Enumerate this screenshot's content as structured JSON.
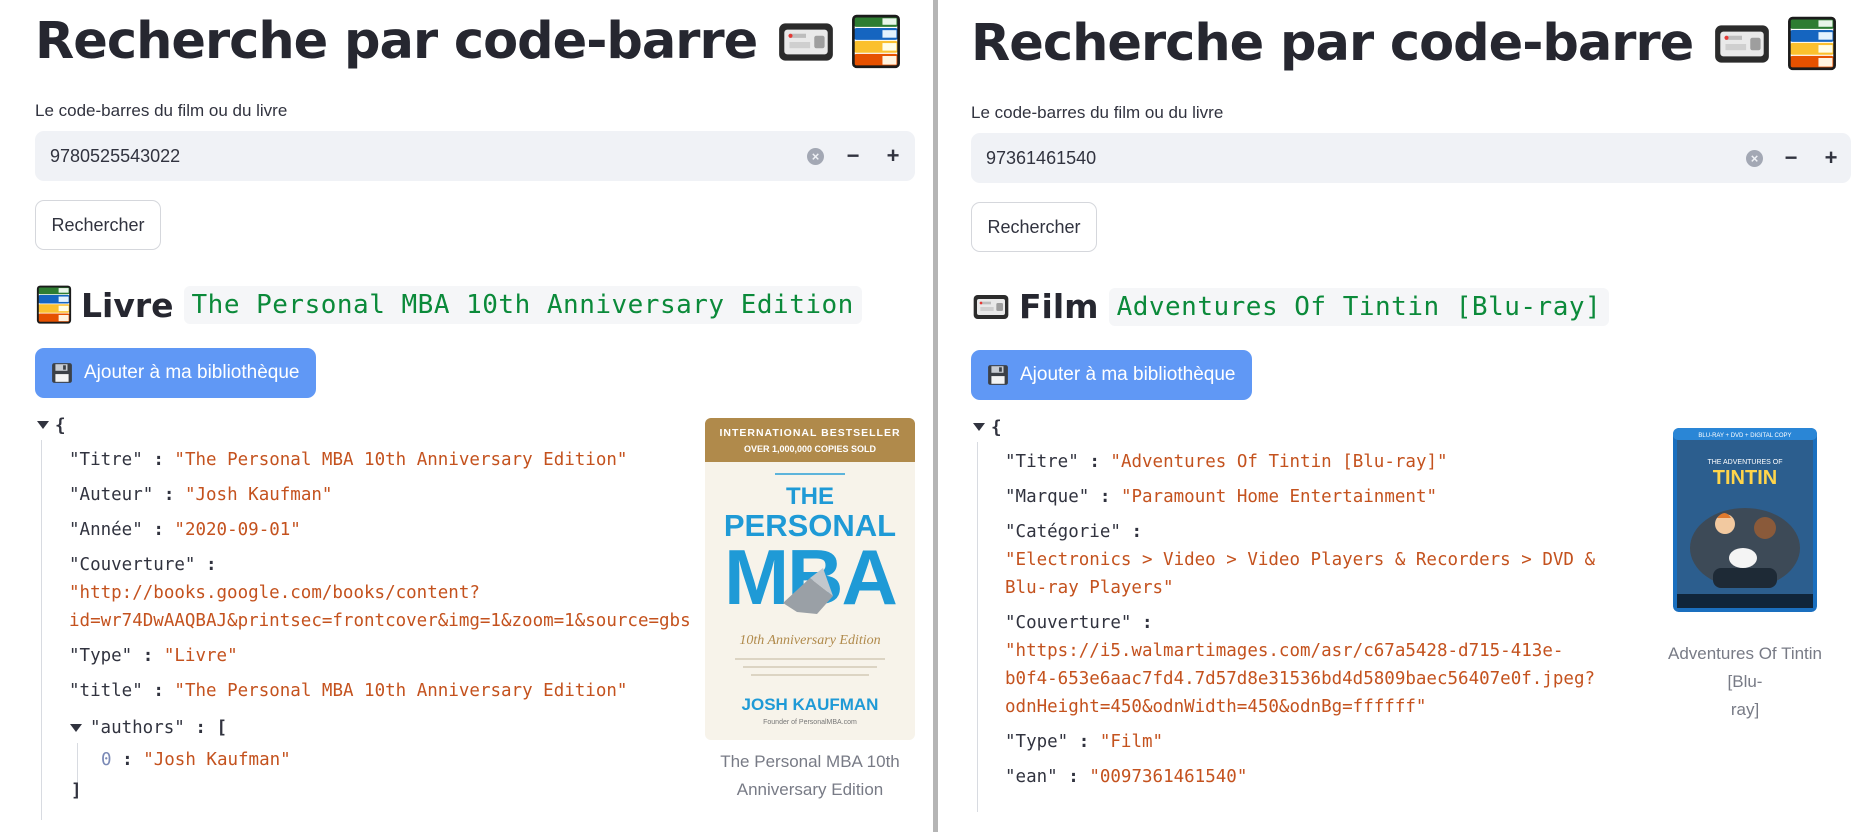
{
  "colors": {
    "primary_button": "#6098f5",
    "json_string": "#c4521e",
    "code_green": "#0b8a3a",
    "input_background": "#f0f2f6"
  },
  "left": {
    "title": "Recherche par code-barre",
    "title_icons": [
      "video-camera-icon",
      "books-icon"
    ],
    "barcode": {
      "label": "Le code-barres du film ou du livre",
      "value": "9780525543022",
      "clear_icon": "clear-icon",
      "minus": "−",
      "plus": "+"
    },
    "search_button": "Rechercher",
    "result": {
      "icon": "books-icon",
      "kind": "Livre",
      "title_code": "The Personal MBA 10th Anniversary Edition"
    },
    "add_button": "Ajouter à ma bibliothèque",
    "add_icon": "floppy-disk-icon",
    "json": {
      "open_brace": "{",
      "entries": [
        {
          "key": "\"Titre\"",
          "value": "\"The Personal MBA 10th Anniversary Edition\""
        },
        {
          "key": "\"Auteur\"",
          "value": "\"Josh Kaufman\""
        },
        {
          "key": "\"Année\"",
          "value": "\"2020-09-01\""
        },
        {
          "key": "\"Couverture\"",
          "value_lines": [
            "\"http://books.google.com/books/content?",
            "id=wr74DwAAQBAJ&printsec=frontcover&img=1&zoom=1&source=gbs"
          ]
        },
        {
          "key": "\"Type\"",
          "value": "\"Livre\""
        },
        {
          "key": "\"title\"",
          "value": "\"The Personal MBA 10th Anniversary Edition\""
        }
      ],
      "authors_key": "\"authors\"",
      "authors_open": "[",
      "authors": [
        {
          "index": "0",
          "value": "\"Josh Kaufman\""
        }
      ],
      "authors_close": "]",
      "separator": ":"
    },
    "cover": {
      "banner_top": "INTERNATIONAL BESTSELLER",
      "banner_bottom": "OVER 1,000,000 COPIES SOLD",
      "the": "THE",
      "personal": "PERSONAL",
      "mba": "MBA",
      "edition": "10th Anniversary Edition",
      "author": "JOSH KAUFMAN",
      "founder": "Founder of PersonalMBA.com",
      "caption": [
        "The Personal MBA 10th",
        "Anniversary Edition"
      ]
    }
  },
  "right": {
    "title": "Recherche par code-barre",
    "title_icons": [
      "video-camera-icon",
      "books-icon"
    ],
    "barcode": {
      "label": "Le code-barres du film ou du livre",
      "value": "97361461540",
      "clear_icon": "clear-icon",
      "minus": "−",
      "plus": "+"
    },
    "search_button": "Rechercher",
    "result": {
      "icon": "video-camera-icon",
      "kind": "Film",
      "title_code": "Adventures Of Tintin [Blu-ray]"
    },
    "add_button": "Ajouter à ma bibliothèque",
    "add_icon": "floppy-disk-icon",
    "json": {
      "open_brace": "{",
      "entries": [
        {
          "key": "\"Titre\"",
          "value": "\"Adventures Of Tintin [Blu-ray]\""
        },
        {
          "key": "\"Marque\"",
          "value": "\"Paramount Home Entertainment\""
        },
        {
          "key": "\"Catégorie\"",
          "value_lines": [
            "\"Electronics > Video > Video Players & Recorders > DVD &",
            "Blu-ray Players\""
          ]
        },
        {
          "key": "\"Couverture\"",
          "value_lines": [
            "\"https://i5.walmartimages.com/asr/c67a5428-d715-413e-",
            "b0f4-653e6aac7fd4.7d57d8e31536bd4d5809baec56407e0f.jpeg?",
            "odnHeight=450&odnWidth=450&odnBg=ffffff\""
          ]
        },
        {
          "key": "\"Type\"",
          "value": "\"Film\""
        },
        {
          "key": "\"ean\"",
          "value": "\"0097361461540\""
        }
      ],
      "separator": ":"
    },
    "cover": {
      "bluray": "BLU-RAY + DVD + DIGITAL COPY",
      "title_small": "THE ADVENTURES OF",
      "title_big": "TINTIN",
      "caption": [
        "Adventures Of Tintin [Blu-",
        "ray]"
      ]
    }
  }
}
